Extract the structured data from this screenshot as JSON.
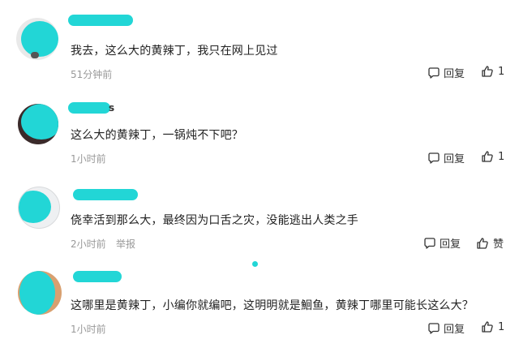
{
  "colors": {
    "redaction": "#22d6d6",
    "muted_text": "#999999",
    "body_text": "#222222"
  },
  "comments": [
    {
      "text": "我去，这么大的黄辣丁，我只在网上见过",
      "time": "51分钟前",
      "reply_label": "回复",
      "like_count": "1",
      "reply_icon": "comment-bubble-icon",
      "like_icon": "thumbs-up-icon"
    },
    {
      "name_tail": "s",
      "text": "这么大的黄辣丁，一锅炖不下吧？",
      "time": "1小时前",
      "reply_label": "回复",
      "like_count": "1"
    },
    {
      "name_tail": "",
      "text": "侥幸活到那么大，最终因为口舌之灾，没能逃出人类之手",
      "time": "2小时前",
      "report_label": "举报",
      "reply_label": "回复",
      "like_label": "赞"
    },
    {
      "text": "这哪里是黄辣丁，小编你就编吧，这明明就是鮰鱼，黄辣丁哪里可能长这么大？",
      "time": "1小时前",
      "reply_label": "回复",
      "like_count": "1"
    }
  ]
}
